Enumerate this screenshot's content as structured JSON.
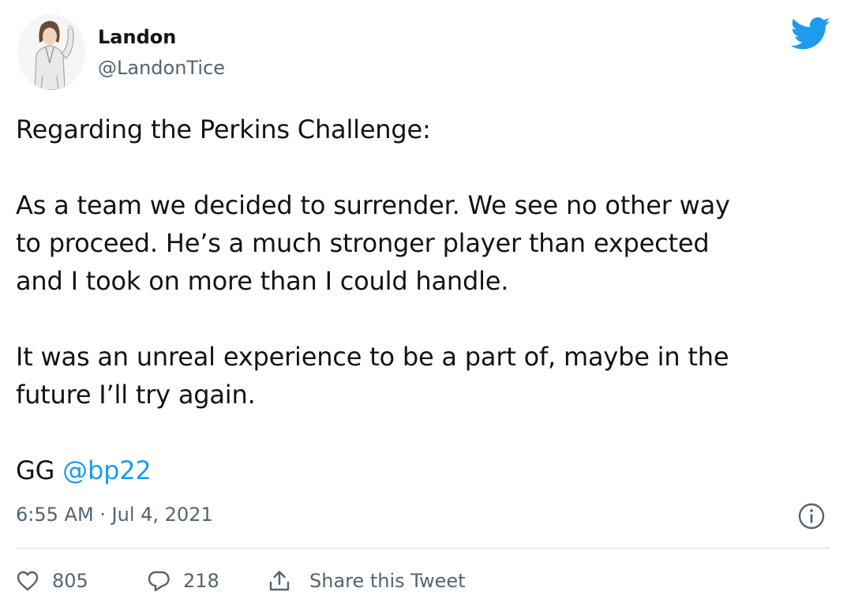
{
  "author": {
    "name": "Landon",
    "handle": "@LandonTice",
    "avatar_icon": "avatar-illustration"
  },
  "tweet": {
    "line1": "Regarding the Perkins Challenge:",
    "paragraph2": "As a team we decided to surrender. We see no other way\nto proceed. He’s a much stronger player than expected\nand I took on more than I could handle.",
    "paragraph3": "It was an unreal experience to be a part of, maybe in the\nfuture I’ll try again.",
    "gg_text": "GG ",
    "mention": "@bp22"
  },
  "timestamp": "6:55 AM · Jul 4, 2021",
  "actions": {
    "likes": "805",
    "replies": "218",
    "share_label": "Share this Tweet"
  },
  "colors": {
    "twitter_blue": "#1d9bf0",
    "text_primary": "#0f1419",
    "text_secondary": "#536471",
    "divider": "#cfd9de"
  },
  "icons": {
    "brand": "twitter-bird-icon",
    "info": "info-icon",
    "like": "heart-icon",
    "reply": "reply-bubble-icon",
    "share": "share-icon"
  }
}
